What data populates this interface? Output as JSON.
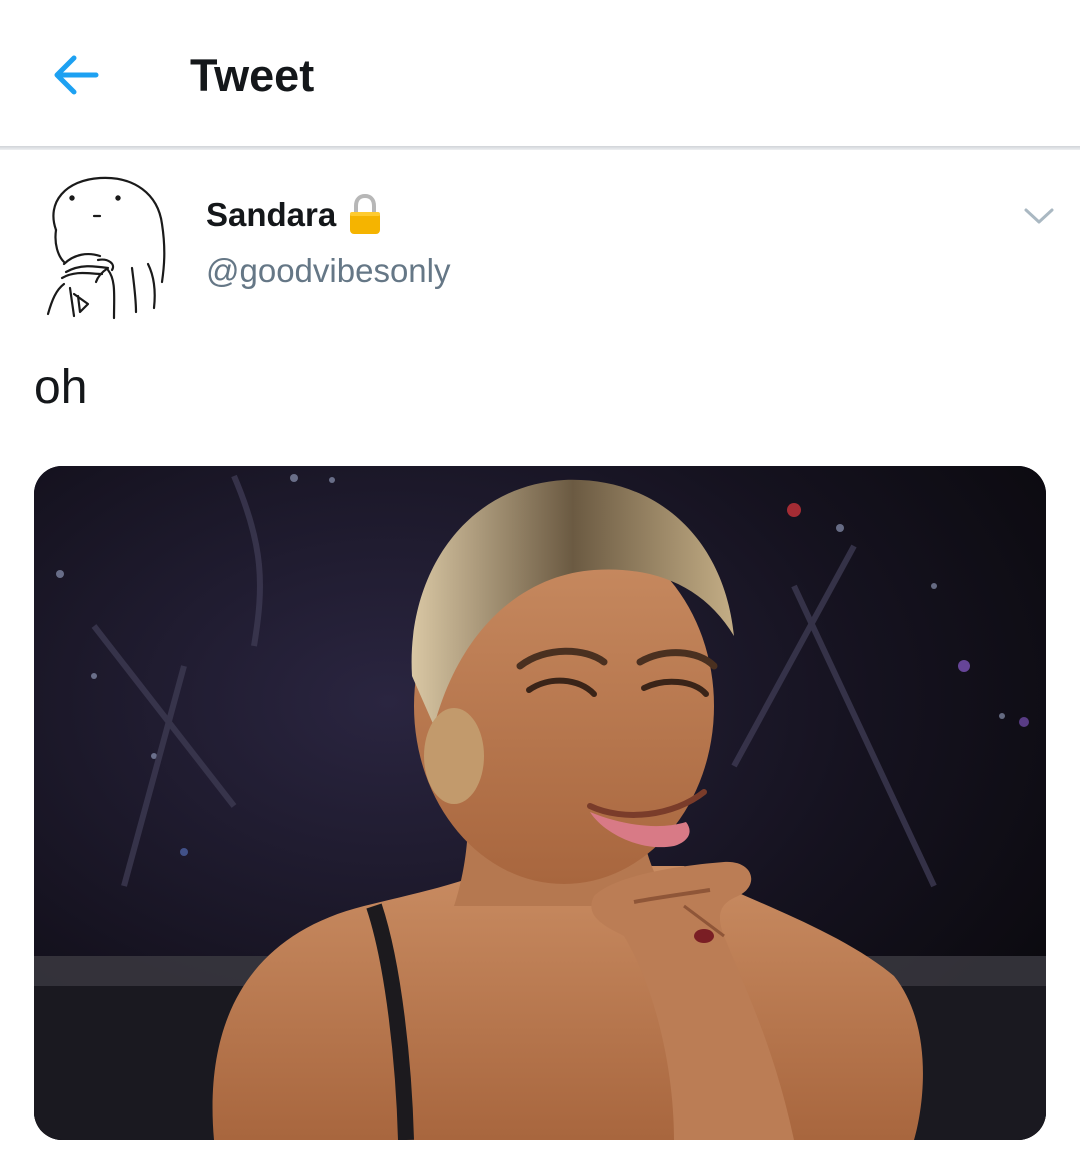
{
  "header": {
    "title": "Tweet",
    "back_icon": "arrow-left-icon",
    "accent_color": "#1da1f2"
  },
  "tweet": {
    "author": {
      "display_name": "Sandara",
      "handle": "@goodvibesonly",
      "protected": true,
      "lock_icon": "lock-icon",
      "avatar_icon": "doodle-avatar-icon"
    },
    "text": "oh",
    "caret_icon": "chevron-down-icon",
    "media": {
      "type": "photo"
    }
  },
  "colors": {
    "primary_text": "#14171a",
    "secondary_text": "#657786",
    "lock": "#f5b400"
  }
}
